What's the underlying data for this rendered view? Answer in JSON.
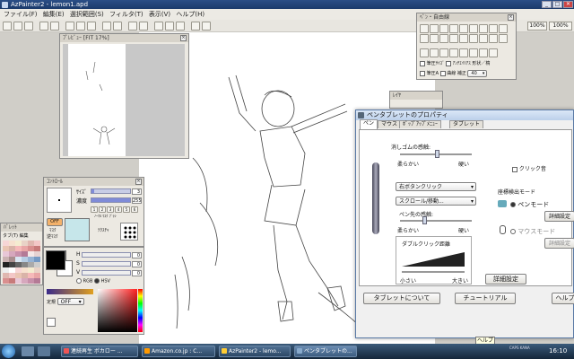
{
  "app": {
    "title": "AzPainter2 - lemon1.apd",
    "win_min": "_",
    "win_max": "□",
    "win_close": "✕"
  },
  "menu": [
    "ファイル(F)",
    "編集(E)",
    "選択範囲(S)",
    "フィルタ(T)",
    "表示(V)",
    "ヘルプ(H)"
  ],
  "toolbar": {
    "zoom_100": "100%",
    "zoom_fit": "100%"
  },
  "preview": {
    "title": "ﾌﾟﾚﾋﾞｭｰ [FIT 17%]"
  },
  "tools_panel": {
    "title": "ﾍﾟﾝ・自由線",
    "row1": [
      "筆圧ｻｲｽﾞ",
      "ｱﾝﾁｴｲﾘｱｽ",
      "形状／楕"
    ],
    "row2": [
      "筆圧A",
      "曲線",
      "補正"
    ],
    "correction_value": "40"
  },
  "layer": {
    "title": "ﾚｲﾔ"
  },
  "control": {
    "title": "ｺﾝﾄﾛｰﾙ",
    "size_label": "ｻｲｽﾞ",
    "size_value": "3",
    "density_label": "濃度",
    "density_value": "255",
    "mask_off": "OFF",
    "mask_label": "ﾏｽｸ",
    "mask_sub": "逆ﾏｽｸ",
    "texture_label": "ﾃｸｽﾁｬ",
    "buttons": [
      "1",
      "2",
      "3",
      "4",
      "5",
      "6"
    ],
    "dot_modes": [
      "ﾉｰﾏﾙ",
      "ﾏｽｸ",
      "ﾌﾞﾗｼ"
    ]
  },
  "palette": {
    "title": "ﾊﾟﾚｯﾄ",
    "tabs": [
      "タブ(T)",
      "編集"
    ]
  },
  "color": {
    "h": "H",
    "s": "S",
    "v": "V",
    "h_val": "0",
    "s_val": "0",
    "v_val": "0",
    "rgb_label": "RGB",
    "hsv_label": "HSV",
    "fixed_label": "定規",
    "fixed_value": "OFF"
  },
  "dialog": {
    "title": "ペンタブレットのプロパティ",
    "tabs": [
      "ペン",
      "マウス",
      "ﾎﾟｯﾌﾟｱｯﾌﾟﾒﾆｭｰ",
      "タブレット"
    ],
    "eraser_label": "消しゴムの感触:",
    "soft": "柔らかい",
    "hard": "硬い",
    "click_sound": "クリック音",
    "button1": "右ボタンクリック",
    "button2": "スクロール/移動...",
    "tip_label": "ペン先の感触:",
    "double_click": "ダブルクリック距離",
    "small": "小さい",
    "large": "大きい",
    "coord_mode": "座標検出モード",
    "pen_mode": "ペンモード",
    "mouse_mode": "マウスモード",
    "detail": "詳細設定",
    "detail2": "詳細設定",
    "detail3": "詳細設定",
    "about_tablet": "タブレットについて",
    "tutorial": "チュートリアル",
    "help": "ヘルプ"
  },
  "help_tooltip": "ヘルプ",
  "taskbar": {
    "tasks": [
      "連続再生 ボカロー ...",
      "Amazon.co.jp : C...",
      "AzPainter2 - lemo...",
      "ペンタブレットの..."
    ],
    "clock": "16:10",
    "status": "CAPS KANA"
  },
  "colors": {
    "accent": "#2b4e86",
    "slider": "#7f8bd8"
  }
}
